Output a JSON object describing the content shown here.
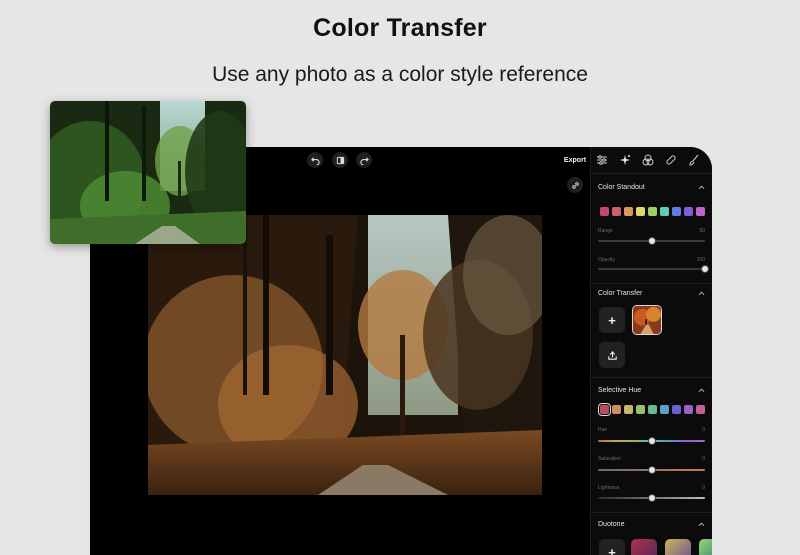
{
  "header": {
    "title": "Color Transfer",
    "subtitle": "Use any photo as a color style reference"
  },
  "toolbar": {
    "export_label": "Export",
    "icons": [
      "undo-icon",
      "compare-icon",
      "redo-icon",
      "link-icon"
    ]
  },
  "panel": {
    "tabs": [
      "adjust-icon",
      "magic-icon",
      "color-circles-icon",
      "bandage-icon",
      "brush-icon"
    ],
    "color_standout": {
      "title": "Color Standout",
      "swatches": [
        "#c8476a",
        "#c9606a",
        "#d79a5a",
        "#e2d56a",
        "#9fcf69",
        "#5fcfb1",
        "#5f7fe0",
        "#7d5fdb",
        "#c062d0"
      ],
      "sliders": [
        {
          "label": "Range",
          "value": "50",
          "level": 0.5
        },
        {
          "label": "Opacity",
          "value": "100",
          "level": 1.0
        }
      ]
    },
    "color_transfer": {
      "title": "Color Transfer"
    },
    "selective_hue": {
      "title": "Selective Hue",
      "swatches": [
        "#b74e5c",
        "#c98e62",
        "#c2b96b",
        "#98c06a",
        "#66be8f",
        "#5d9bc8",
        "#6d5fd0",
        "#9a5fc8",
        "#c0609a"
      ],
      "selected_index": 0,
      "sliders": [
        {
          "label": "Hue",
          "value": "0",
          "level": 0.5
        },
        {
          "label": "Saturation",
          "value": "0",
          "level": 0.5
        },
        {
          "label": "Lightness",
          "value": "0",
          "level": 0.5
        }
      ]
    },
    "duotone": {
      "title": "Duotone"
    }
  }
}
